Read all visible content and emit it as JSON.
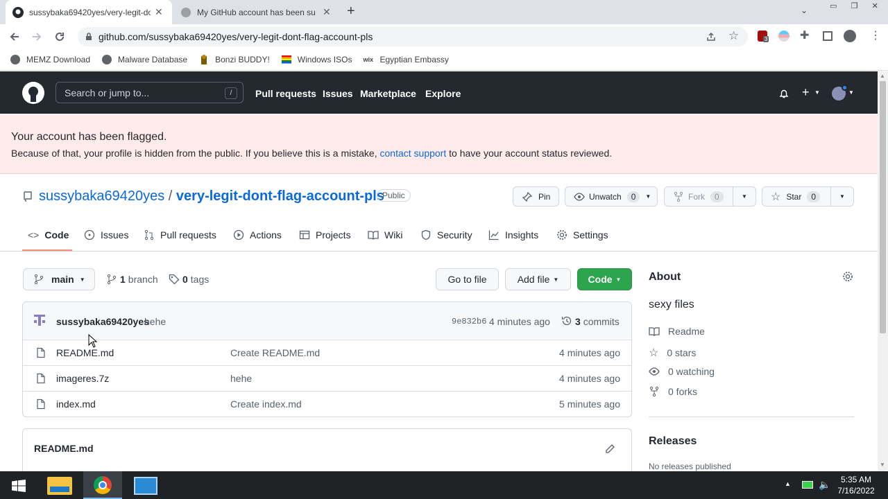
{
  "browser": {
    "tabs": [
      {
        "title": "sussybaka69420yes/very-legit-do",
        "active": true
      },
      {
        "title": "My GitHub account has been su",
        "active": false
      }
    ],
    "url": "github.com/sussybaka69420yes/very-legit-dont-flag-account-pls",
    "extension_badge": "3",
    "bookmarks": [
      "MEMZ Download",
      "Malware Database",
      "Bonzi BUDDY!",
      "Windows ISOs",
      "Egyptian Embassy"
    ]
  },
  "gh_header": {
    "search_placeholder": "Search or jump to...",
    "search_key": "/",
    "nav": [
      "Pull requests",
      "Issues",
      "Marketplace",
      "Explore"
    ]
  },
  "flash": {
    "title": "Your account has been flagged.",
    "text_before": "Because of that, your profile is hidden from the public. If you believe this is a mistake, ",
    "link": "contact support",
    "text_after": " to have your account status reviewed."
  },
  "repo": {
    "owner": "sussybaka69420yes",
    "separator": "/",
    "name": "very-legit-dont-flag-account-pls",
    "visibility": "Public",
    "pin_label": "Pin",
    "unwatch_label": "Unwatch",
    "unwatch_count": "0",
    "fork_label": "Fork",
    "fork_count": "0",
    "star_label": "Star",
    "star_count": "0"
  },
  "tabs": [
    "Code",
    "Issues",
    "Pull requests",
    "Actions",
    "Projects",
    "Wiki",
    "Security",
    "Insights",
    "Settings"
  ],
  "branch": {
    "name": "main",
    "branches_count": "1",
    "branches_label": "branch",
    "tags_count": "0",
    "tags_label": "tags"
  },
  "buttons": {
    "go_to_file": "Go to file",
    "add_file": "Add file",
    "code": "Code"
  },
  "commit": {
    "author": "sussybaka69420yes",
    "message": "hehe",
    "sha": "9e832b6",
    "time": "4 minutes ago",
    "commits_count": "3",
    "commits_label": "commits"
  },
  "files": [
    {
      "name": "README.md",
      "message": "Create README.md",
      "age": "4 minutes ago"
    },
    {
      "name": "imageres.7z",
      "message": "hehe",
      "age": "4 minutes ago"
    },
    {
      "name": "index.md",
      "message": "Create index.md",
      "age": "5 minutes ago"
    }
  ],
  "readme": {
    "title": "README.md"
  },
  "about": {
    "heading": "About",
    "description": "sexy files",
    "readme": "Readme",
    "stars": "0 stars",
    "watching": "0 watching",
    "forks": "0 forks"
  },
  "releases": {
    "heading": "Releases",
    "text": "No releases published"
  },
  "taskbar": {
    "time": "5:35 AM",
    "date": "7/16/2022"
  },
  "colors": {
    "accent": "#0969da",
    "green": "#2da44e",
    "header_bg": "#24292f",
    "flash_bg": "#ffebe9",
    "tab_underline": "#fd8c73"
  }
}
